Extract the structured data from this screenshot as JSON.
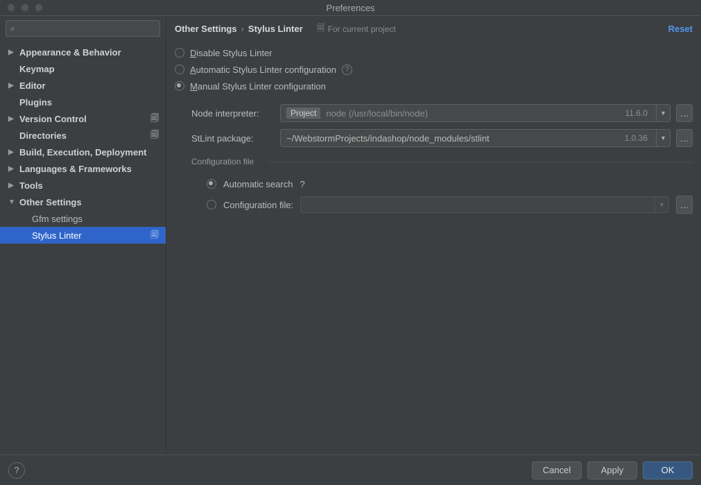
{
  "window": {
    "title": "Preferences"
  },
  "search": {
    "placeholder": ""
  },
  "sidebar": {
    "items": [
      {
        "name": "appearance-behavior",
        "label": "Appearance & Behavior",
        "expandable": true,
        "bold": true
      },
      {
        "name": "keymap",
        "label": "Keymap",
        "expandable": false,
        "bold": true
      },
      {
        "name": "editor",
        "label": "Editor",
        "expandable": true,
        "bold": true
      },
      {
        "name": "plugins",
        "label": "Plugins",
        "expandable": false,
        "bold": true
      },
      {
        "name": "version-control",
        "label": "Version Control",
        "expandable": true,
        "bold": true,
        "badge": true
      },
      {
        "name": "directories",
        "label": "Directories",
        "expandable": false,
        "bold": true,
        "badge": true
      },
      {
        "name": "build-execution",
        "label": "Build, Execution, Deployment",
        "expandable": true,
        "bold": true
      },
      {
        "name": "languages-frameworks",
        "label": "Languages & Frameworks",
        "expandable": true,
        "bold": true
      },
      {
        "name": "tools",
        "label": "Tools",
        "expandable": true,
        "bold": true
      },
      {
        "name": "other-settings",
        "label": "Other Settings",
        "expandable": true,
        "expanded": true,
        "bold": true
      }
    ],
    "children": [
      {
        "name": "gfm-settings",
        "label": "Gfm settings"
      },
      {
        "name": "stylus-linter",
        "label": "Stylus Linter",
        "selected": true,
        "badge": true
      }
    ]
  },
  "breadcrumb": {
    "root": "Other Settings",
    "sep": "›",
    "leaf": "Stylus Linter",
    "project_tag": "For current project",
    "reset": "Reset"
  },
  "radios": {
    "disable": "Disable Stylus Linter",
    "automatic": "Automatic Stylus Linter configuration",
    "manual": "Manual Stylus Linter configuration"
  },
  "fields": {
    "node_label": "Node interpreter:",
    "node_project": "Project",
    "node_value": "node (/usr/local/bin/node)",
    "node_version": "11.6.0",
    "stlint_label": "StLint package:",
    "stlint_value": "~/WebstormProjects/indashop/node_modules/stlint",
    "stlint_version": "1.0.36",
    "browse": "…"
  },
  "fieldset": {
    "title": "Configuration file",
    "auto_label": "Automatic search",
    "file_label": "Configuration file:"
  },
  "footer": {
    "cancel": "Cancel",
    "apply": "Apply",
    "ok": "OK"
  }
}
